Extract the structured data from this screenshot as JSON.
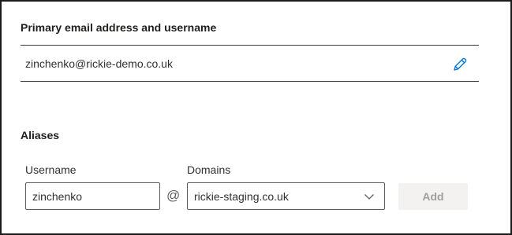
{
  "primary": {
    "title": "Primary email address and username",
    "email": "zinchenko@rickie-demo.co.uk",
    "edit_icon": "pencil-icon"
  },
  "aliases": {
    "title": "Aliases",
    "username_label": "Username",
    "username_value": "zinchenko",
    "at_sign": "@",
    "domains_label": "Domains",
    "domain_selected": "rickie-staging.co.uk",
    "add_label": "Add",
    "add_enabled": false
  },
  "colors": {
    "accent": "#0078d4",
    "text": "#323130",
    "border": "#605e5c",
    "disabled_bg": "#f3f2f1",
    "disabled_text": "#a19f9d"
  }
}
